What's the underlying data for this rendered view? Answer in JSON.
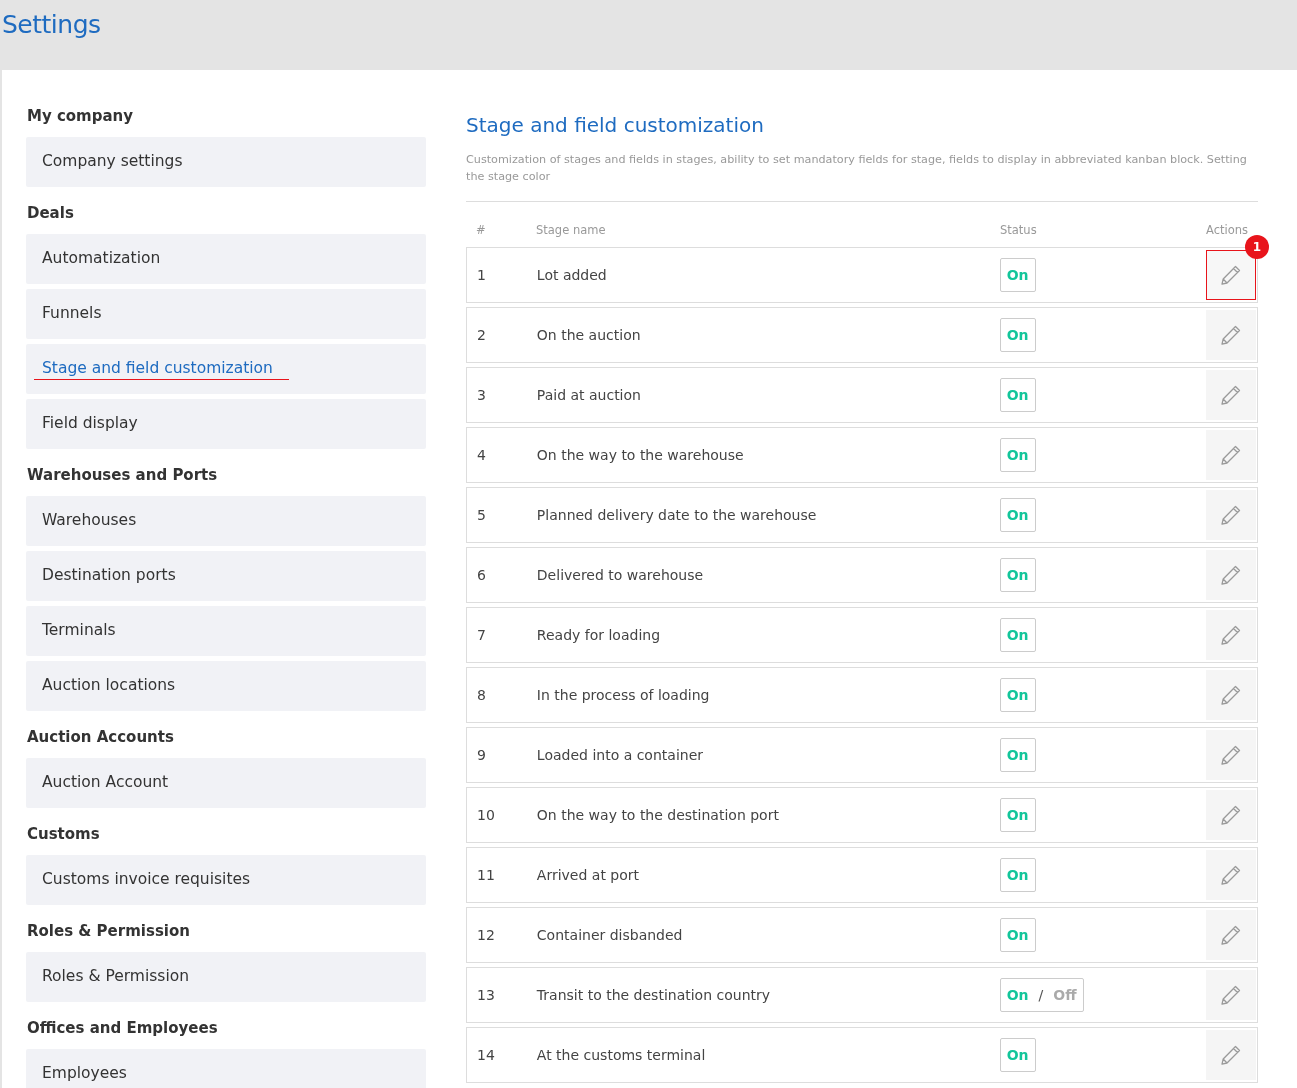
{
  "page_title": "Settings",
  "sidebar": {
    "groups": [
      {
        "heading": "My company",
        "items": [
          {
            "label": "Company settings",
            "selected": false
          }
        ]
      },
      {
        "heading": "Deals",
        "items": [
          {
            "label": "Automatization",
            "selected": false
          },
          {
            "label": "Funnels",
            "selected": false
          },
          {
            "label": "Stage and field customization",
            "selected": true
          },
          {
            "label": "Field display",
            "selected": false
          }
        ]
      },
      {
        "heading": "Warehouses and Ports",
        "items": [
          {
            "label": "Warehouses",
            "selected": false
          },
          {
            "label": "Destination ports",
            "selected": false
          },
          {
            "label": "Terminals",
            "selected": false
          },
          {
            "label": "Auction locations",
            "selected": false
          }
        ]
      },
      {
        "heading": "Auction Accounts",
        "items": [
          {
            "label": "Auction Account",
            "selected": false
          }
        ]
      },
      {
        "heading": "Customs",
        "items": [
          {
            "label": "Customs invoice requisites",
            "selected": false
          }
        ]
      },
      {
        "heading": "Roles & Permission",
        "items": [
          {
            "label": "Roles & Permission",
            "selected": false
          }
        ]
      },
      {
        "heading": "Offices and Employees",
        "items": [
          {
            "label": "Employees",
            "selected": false
          }
        ]
      }
    ]
  },
  "content": {
    "title": "Stage and field customization",
    "description": "Customization of stages and fields in stages, ability to set mandatory fields for stage, fields to display in abbreviated kanban block. Setting the stage color",
    "table": {
      "columns": [
        "#",
        "Stage name",
        "Status",
        "Actions"
      ],
      "rows": [
        {
          "number": "1",
          "name": "Lot added",
          "status": {
            "on": "On"
          },
          "highlighted": true,
          "badge": "1"
        },
        {
          "number": "2",
          "name": "On the auction",
          "status": {
            "on": "On"
          },
          "highlighted": false
        },
        {
          "number": "3",
          "name": "Paid at auction",
          "status": {
            "on": "On"
          },
          "highlighted": false
        },
        {
          "number": "4",
          "name": "On the way to the warehouse",
          "status": {
            "on": "On"
          },
          "highlighted": false
        },
        {
          "number": "5",
          "name": "Planned delivery date to the warehouse",
          "status": {
            "on": "On"
          },
          "highlighted": false
        },
        {
          "number": "6",
          "name": "Delivered to warehouse",
          "status": {
            "on": "On"
          },
          "highlighted": false
        },
        {
          "number": "7",
          "name": "Ready for loading",
          "status": {
            "on": "On"
          },
          "highlighted": false
        },
        {
          "number": "8",
          "name": "In the process of loading",
          "status": {
            "on": "On"
          },
          "highlighted": false
        },
        {
          "number": "9",
          "name": "Loaded into a container",
          "status": {
            "on": "On"
          },
          "highlighted": false
        },
        {
          "number": "10",
          "name": "On the way to the destination port",
          "status": {
            "on": "On"
          },
          "highlighted": false
        },
        {
          "number": "11",
          "name": "Arrived at port",
          "status": {
            "on": "On"
          },
          "highlighted": false
        },
        {
          "number": "12",
          "name": "Container disbanded",
          "status": {
            "on": "On"
          },
          "highlighted": false
        },
        {
          "number": "13",
          "name": "Transit to the destination country",
          "status": {
            "on": "On",
            "separator": "/",
            "off": "Off"
          },
          "highlighted": false
        },
        {
          "number": "14",
          "name": "At the customs terminal",
          "status": {
            "on": "On"
          },
          "highlighted": false
        }
      ]
    }
  }
}
